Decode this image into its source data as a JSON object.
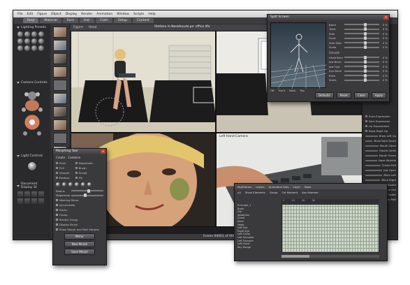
{
  "menubar": [
    "File",
    "Edit",
    "Figure",
    "Object",
    "Display",
    "Render",
    "Animation",
    "Window",
    "Scripts",
    "Help"
  ],
  "room_tabs": [
    "Pose",
    "Material",
    "Face",
    "Hair",
    "Cloth",
    "Setup",
    "Content"
  ],
  "left_panel": {
    "lighting_title": "Lighting Presets",
    "camera_title": "Camera Controls",
    "light_title": "Light Controls",
    "display_title": "Document Display St"
  },
  "viewport": {
    "title": "Stefano in Nosehoudz.pz: office life",
    "figure_label": "Figure",
    "object_label": "Head",
    "cam4_label": "Left Hand Camera",
    "frame_label": "Frame",
    "frame_value": "00001",
    "frame_total": "00030"
  },
  "split_dialog": {
    "title": "Split Screen",
    "sliders": [
      {
        "name": "Bend",
        "value": "0 %"
      },
      {
        "name": "Twist",
        "value": "0 %"
      },
      {
        "name": "Side",
        "value": "0 %"
      },
      {
        "name": "Front",
        "value": "0 %"
      },
      {
        "name": "Side-Side",
        "value": "0 %"
      },
      {
        "name": "Scale",
        "value": "0 %"
      }
    ],
    "subsection": "Smooth",
    "sliders2": [
      {
        "name": "Head Bend",
        "value": "0 %"
      },
      {
        "name": "Jaw Bend",
        "value": "0 %"
      },
      {
        "name": "Jaw Fwd",
        "value": "0 %"
      },
      {
        "name": "Eye Bend",
        "value": "0 %"
      },
      {
        "name": "Blink",
        "value": "0 %"
      },
      {
        "name": "Smile",
        "value": "0 %"
      }
    ],
    "radio_options": [
      "Off",
      "Front",
      "Back",
      "Top"
    ],
    "buttons": [
      "Defaults",
      "Reset",
      "Close",
      "Apply"
    ]
  },
  "morph_dialog": {
    "title": "Morphing Tool",
    "tab_create": "Create",
    "tab_combine": "Combine",
    "options_col1": [
      "Push",
      "Pull",
      "Smooth",
      "Restore"
    ],
    "options_col2": [
      "Magnitude",
      "Brush",
      "Sculpt",
      "Pin"
    ],
    "sliders": [
      "Radius",
      "Magnitude"
    ],
    "checks": [
      "Working Mirror",
      "Accumulate",
      "Sticky",
      "Group",
      "Stretch Group",
      "Display Brush",
      "Show Morph and Path Morphs"
    ],
    "buttons": [
      "Mirror",
      "New Morph",
      "Save Morph"
    ]
  },
  "timeline": {
    "toolbar": [
      "Keyframes",
      "Layers",
      "Animation Sets"
    ],
    "layer_label": "Layer",
    "base_label": "Base",
    "sub_toolbar": [
      "All",
      "Show Elements",
      "Group",
      "Col Moment",
      "Key Moment"
    ],
    "tracks": [
      "Principal_1",
      "Body",
      "Hip",
      "Abdomen",
      "Chest",
      "Neck",
      "Head",
      "Left Eye",
      "Right Eye",
      "Left Collar",
      "Left Shoulder",
      "Left Forearm",
      "Left Hand",
      "Key Range"
    ],
    "header_ticks": [
      "1",
      "10",
      "20",
      "30"
    ]
  },
  "right_panel": {
    "rows": [
      "Eyes Expression",
      "Face Expression",
      "Lip Expressions",
      "Brow Right Up",
      "Brow Left Up",
      "Brow Both Down",
      "Mouth Open",
      "Mouth Smile",
      "Mouth Frown",
      "Nose Wrinkle",
      "Cheek Puff",
      "Jaw Open",
      "Blink Left",
      "Blink Right",
      "Squint",
      "Tongue Out",
      "Lips Pucker",
      "Lips Part"
    ]
  }
}
